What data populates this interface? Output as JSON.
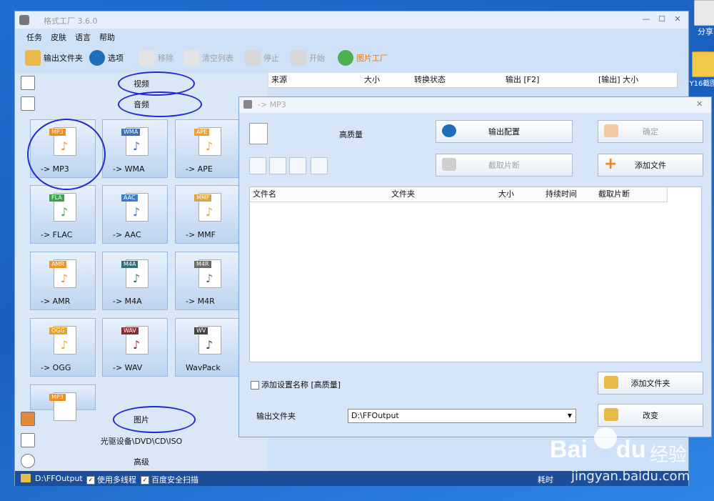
{
  "desktop": {
    "icon1_label": "分享",
    "icon2_label": "Y16截图"
  },
  "main_window": {
    "title": "格式工厂 3.6.0",
    "menu": [
      "任务",
      "皮肤",
      "语言",
      "帮助"
    ],
    "toolbar": {
      "output_folder": "输出文件夹",
      "options": "选项",
      "remove": "移除",
      "clear_list": "清空列表",
      "stop": "停止",
      "start": "开始",
      "image_factory": "图片工厂"
    },
    "categories": {
      "video": "视频",
      "audio": "音频",
      "image": "图片",
      "optical": "光驱设备\\DVD\\CD\\ISO",
      "advanced": "高级"
    },
    "audio_formats": [
      {
        "tag": "MP3",
        "label": "-> MP3",
        "color": "#f08c1e"
      },
      {
        "tag": "WMA",
        "label": "-> WMA",
        "color": "#3b6fb6"
      },
      {
        "tag": "APE",
        "label": "-> APE",
        "color": "#e5a23a"
      },
      {
        "tag": "FLA",
        "label": "-> FLAC",
        "color": "#3aa24b"
      },
      {
        "tag": "AAC",
        "label": "-> AAC",
        "color": "#3c7cc9"
      },
      {
        "tag": "MMF",
        "label": "-> MMF",
        "color": "#d9a441"
      },
      {
        "tag": "AMR",
        "label": "-> AMR",
        "color": "#f0932b"
      },
      {
        "tag": "M4A",
        "label": "-> M4A",
        "color": "#2f6f73"
      },
      {
        "tag": "M4R",
        "label": "-> M4R",
        "color": "#6a6a6a"
      },
      {
        "tag": "OGG",
        "label": "-> OGG",
        "color": "#f0a020"
      },
      {
        "tag": "WAV",
        "label": "-> WAV",
        "color": "#8b2b2b"
      },
      {
        "tag": "WV",
        "label": "WavPack",
        "color": "#444444"
      },
      {
        "tag": "MP3",
        "label": "",
        "color": "#f08c1e"
      }
    ],
    "task_columns": [
      "来源",
      "大小",
      "转换状态",
      "输出 [F2]",
      "[输出] 大小"
    ],
    "status": {
      "output_path": "D:\\FFOutput",
      "multithread": "使用多线程",
      "safe_scan": "百度安全扫描",
      "elapsed": "耗时"
    }
  },
  "dialog": {
    "title": "-> MP3",
    "quality": "高质量",
    "output_config": "输出配置",
    "ok": "确定",
    "clip": "截取片断",
    "add_file": "添加文件",
    "columns": [
      "文件名",
      "文件夹",
      "大小",
      "持续时间",
      "截取片断"
    ],
    "add_setting_name": "添加设置名称 [高质量]",
    "add_folder": "添加文件夹",
    "output_folder_label": "输出文件夹",
    "output_folder_value": "D:\\FFOutput",
    "change": "改变"
  },
  "watermark": {
    "brand": "Bai",
    "brand2": "du",
    "suffix": "经验",
    "url": "jingyan.baidu.com"
  }
}
